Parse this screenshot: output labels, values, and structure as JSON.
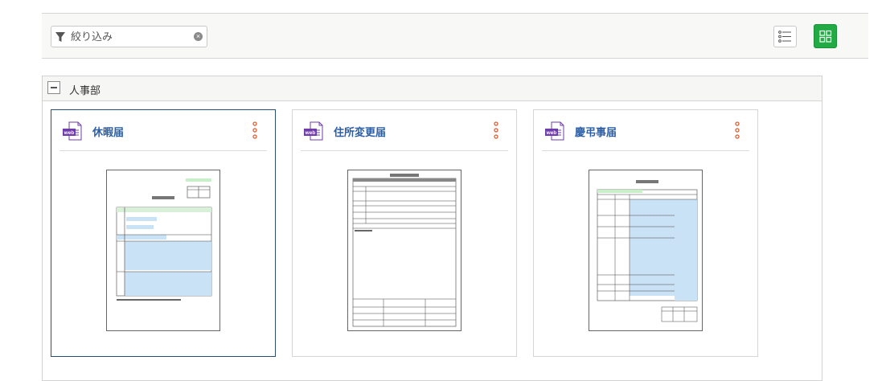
{
  "filter": {
    "placeholder": "絞り込み",
    "value": ""
  },
  "view": {
    "list_icon": "list-view-icon",
    "grid_icon": "grid-view-icon",
    "active": "grid",
    "active_color": "#22aa44"
  },
  "group": {
    "title": "人事部",
    "cards": [
      {
        "title": "休暇届",
        "badge": "web",
        "selected": true
      },
      {
        "title": "住所変更届",
        "badge": "web",
        "selected": false
      },
      {
        "title": "慶弔事届",
        "badge": "web",
        "selected": false
      }
    ]
  },
  "colors": {
    "title_blue": "#2b5ea5",
    "badge_purple": "#6f3cab",
    "menu_red": "#e05a2b",
    "selected_border": "#2a4e78"
  }
}
